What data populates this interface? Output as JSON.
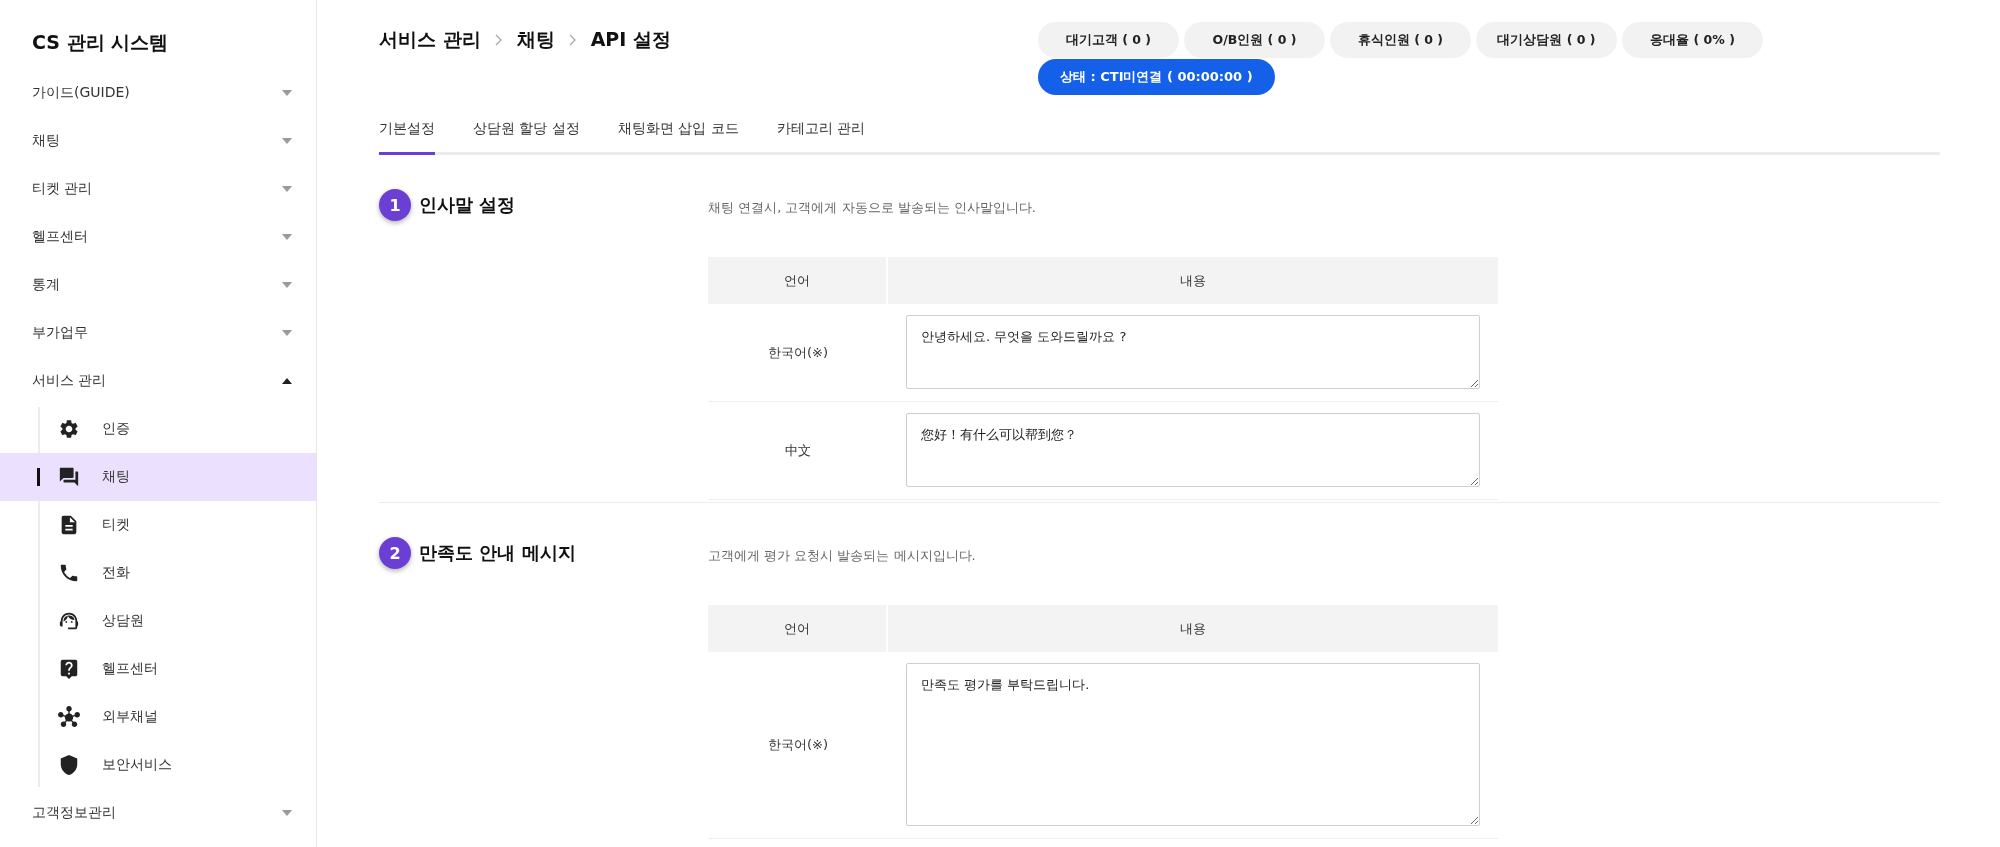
{
  "sidebar": {
    "title": "CS 관리 시스템",
    "items": [
      {
        "label": "가이드(GUIDE)",
        "expanded": false
      },
      {
        "label": "채팅",
        "expanded": false
      },
      {
        "label": "티켓 관리",
        "expanded": false
      },
      {
        "label": "헬프센터",
        "expanded": false
      },
      {
        "label": "통계",
        "expanded": false
      },
      {
        "label": "부가업무",
        "expanded": false
      },
      {
        "label": "서비스 관리",
        "expanded": true,
        "children": [
          {
            "label": "인증",
            "kind": "gear",
            "selected": false
          },
          {
            "label": "채팅",
            "kind": "chat",
            "selected": true
          },
          {
            "label": "티켓",
            "kind": "note",
            "selected": false
          },
          {
            "label": "전화",
            "kind": "phone",
            "selected": false
          },
          {
            "label": "상담원",
            "kind": "agent",
            "selected": false
          },
          {
            "label": "헬프센터",
            "kind": "help",
            "selected": false
          },
          {
            "label": "외부채널",
            "kind": "channel",
            "selected": false
          },
          {
            "label": "보안서비스",
            "kind": "shield",
            "selected": false
          }
        ]
      },
      {
        "label": "고객정보관리",
        "expanded": false
      }
    ]
  },
  "breadcrumb": [
    "서비스 관리",
    "채팅",
    "API 설정"
  ],
  "stats": [
    "대기고객 ( 0 )",
    "O/B인원 ( 0 )",
    "휴식인원 ( 0 )",
    "대기상담원 ( 0 )",
    "응대율 ( 0% )"
  ],
  "status": "상태 : CTI미연결 ( 00:00:00 )",
  "tabs": [
    {
      "label": "기본설정",
      "selected": true
    },
    {
      "label": "상담원 할당 설정",
      "selected": false
    },
    {
      "label": "채팅화면 삽입 코드",
      "selected": false
    },
    {
      "label": "카테고리 관리",
      "selected": false
    }
  ],
  "sections": [
    {
      "number": "1",
      "title": "인사말 설정",
      "description": "채팅 연결시, 고객에게 자동으로 발송되는 인사말입니다.",
      "columns": [
        "언어",
        "내용"
      ],
      "rows": [
        {
          "language": "한국어(※)",
          "value": "안녕하세요. 무엇을 도와드릴까요 ?",
          "tall": false
        },
        {
          "language": "中文",
          "value": "您好！有什么可以帮到您？",
          "tall": false
        }
      ]
    },
    {
      "number": "2",
      "title": "만족도 안내 메시지",
      "description": "고객에게 평가 요청시 발송되는 메시지입니다.",
      "columns": [
        "언어",
        "내용"
      ],
      "rows": [
        {
          "language": "한국어(※)",
          "value": "만족도 평가를 부탁드립니다.",
          "tall": true
        }
      ]
    }
  ]
}
